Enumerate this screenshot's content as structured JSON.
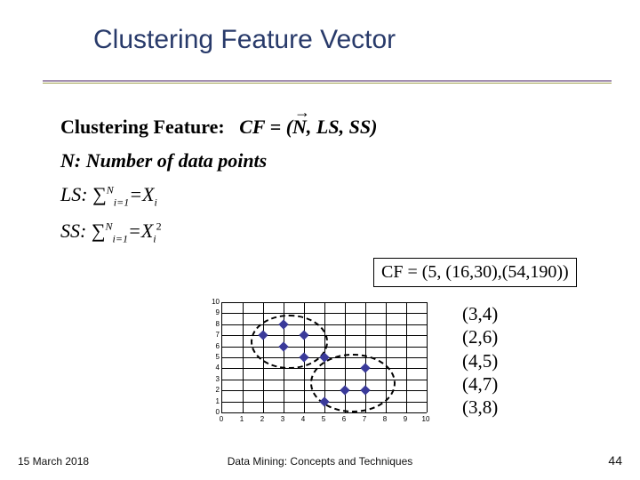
{
  "title": "Clustering Feature Vector",
  "cf_label": "Clustering Feature:",
  "cf_formula": "CF = (N, LS, SS)",
  "n_def": "N: Number of data points",
  "ls_label": "LS:",
  "ss_label": "SS:",
  "formula_parts": {
    "sigma": "∑",
    "sup_N": "N",
    "sub_i1": "i=1",
    "eq": "=X",
    "sub_i": "i",
    "sq": "2"
  },
  "cf_example": "CF = (5, (16,30),(54,190))",
  "data_points": {
    "p1": "(3,4)",
    "p2": "(2,6)",
    "p3": "(4,5)",
    "p4": "(4,7)",
    "p5": "(3,8)"
  },
  "chart_data": {
    "type": "scatter",
    "x": [
      2,
      3,
      3,
      4,
      4,
      5,
      5,
      6,
      7,
      7
    ],
    "y": [
      7,
      6,
      8,
      5,
      7,
      1,
      5,
      2,
      2,
      4
    ],
    "clusters": [
      {
        "cx": 3.2,
        "cy": 6.6,
        "rx": 1.8,
        "ry": 2.3
      },
      {
        "cx": 6.3,
        "cy": 2.8,
        "rx": 2.0,
        "ry": 2.5
      }
    ],
    "xlim": [
      0,
      10
    ],
    "ylim": [
      0,
      10
    ],
    "xticks": [
      0,
      1,
      2,
      3,
      4,
      5,
      6,
      7,
      8,
      9,
      10
    ],
    "yticks": [
      0,
      1,
      2,
      3,
      4,
      5,
      6,
      7,
      8,
      9,
      10
    ],
    "title": "",
    "xlabel": "",
    "ylabel": ""
  },
  "footer": {
    "date": "15 March 2018",
    "center": "Data Mining: Concepts and Techniques",
    "page": "44"
  }
}
